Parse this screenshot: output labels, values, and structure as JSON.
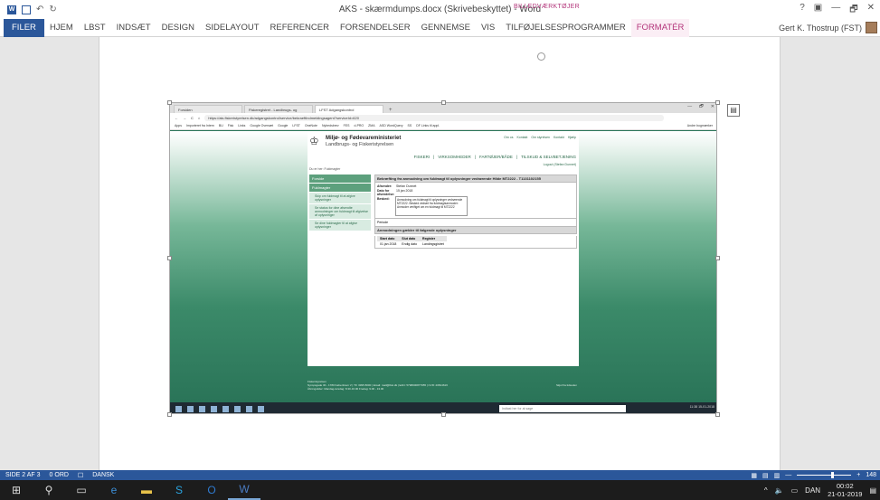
{
  "word": {
    "title": "AKS - skærmdumps.docx (Skrivebeskyttet) - Word",
    "context_group": "BILLEDVÆRKTØJER",
    "window_controls": [
      "?",
      "▣",
      "—",
      "🗗",
      "✕"
    ],
    "tabs": [
      "FILER",
      "HJEM",
      "LBST",
      "INDSÆT",
      "DESIGN",
      "SIDELAYOUT",
      "REFERENCER",
      "FORSENDELSER",
      "GENNEMSE",
      "VIS",
      "TILFØJELSESPROGRAMMER",
      "FORMATÉR"
    ],
    "user": "Gert K. Thostrup (FST)",
    "status": {
      "page": "SIDE 2 AF 3",
      "words": "0 ORD",
      "language": "DANSK",
      "zoom": "148"
    }
  },
  "screenshot": {
    "browser_tabs": [
      "Forsiden",
      "Fiskeregistret - Landbrugs- og",
      "LFST Adgangskontrol"
    ],
    "new_tab": "+",
    "url": "https://ais.fiskeristyrelsen.dk/adgangskontrol/service/bekraeftIndmeldingsagent?serviceId=620",
    "bookmarks": [
      "Apps",
      "Importeret fra Intern",
      "BU",
      "Fisk",
      "Links",
      "Google Oversæt",
      "Google",
      "LFST",
      "OneNote",
      "Nyhedsbrev",
      "FES",
      "d-PRO",
      "ZMA",
      "ASD WordQuery",
      "SS",
      "DF Links til appl."
    ],
    "bookmarks_other": "Andre bogmærker",
    "site": {
      "ministry": "Miljø- og Fødevareministeriet",
      "agency": "Landbrugs- og Fiskeristyrelsen",
      "toplinks": [
        "Om os",
        "Kontakt",
        "Om styrelsen",
        "Kontakt",
        "Hjælp"
      ],
      "mainnav": [
        "FISKERI",
        "VIRKSOMHEDER",
        "FARTØJER/BÅDE",
        "TILSKUD & SELVBETJENING"
      ],
      "logout": "Logout (Stefan Dunnet)",
      "breadcrumb": "Du er her: Fuldmagter",
      "leftnav": [
        "Forside",
        "Fuldmagter"
      ],
      "leftnav_sub": [
        "Skip om fuldmagt til at afgive oplysninger",
        "Se status for dine afsendte anmodninger om fuldmagt til afgivelse af oplysninger",
        "Se dine fuldmagter til at afgive oplysninger"
      ],
      "panel_title": "Bekræfting fra anmodning om fuldmagt til oplysninger vedrørende Hilde MT2222 - T1131102155",
      "afsender_label": "Afsender:",
      "afsender": "Stefan Dunnet",
      "dato_label": "Dato for afsendelse:",
      "dato": "15 jan 2018",
      "besked_label": "Besked:",
      "besked": "Anmodning om fuldmagt til oplysninger vedrørende MT2222. Besked vedrørt fra fuldmagtsanmoder: Anmoder verifiget om en fuldmagt til MT2222",
      "periode": "Periode",
      "scope_title": "Anmodningen gælder til følgende oplysninger",
      "table_headers": [
        "Start dato",
        "Slut dato",
        "Register"
      ],
      "table_row": [
        "01 jan 2018",
        "Endig dato",
        "Landingsgistret"
      ],
      "footer_line1": "Fiskeristyrelsen",
      "footer_line2": "Nyropsgade 30 - 1780 København V | Tlf. 3395 8000 | Email: mail@lbst.dk | EAN: 5798000877955 | CVR: 20814616",
      "footer_line3": "Åbningstider: Mandag-torsdag: 8.30-16.00 Fredag: 9.00 - 13.00",
      "footer_right": "Skjul fra tidsuden"
    },
    "taskbar_search": "Indtast her for at søge",
    "taskbar_time": "11:38",
    "taskbar_date": "15-01-2018"
  },
  "taskbar": {
    "tray_lang": "DAN",
    "time": "00:02",
    "date": "21-01-2019"
  },
  "colors": {
    "word_blue": "#2b579a",
    "context_pink": "#b3347a",
    "site_green": "#2a7458"
  }
}
